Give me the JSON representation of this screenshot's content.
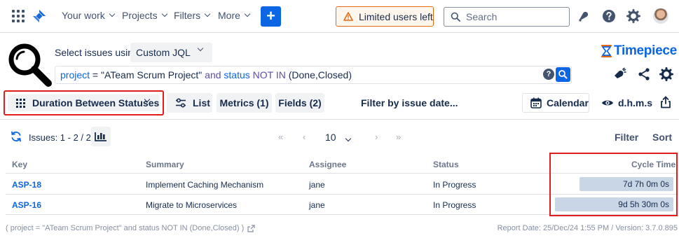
{
  "nav": {
    "items": [
      {
        "label": "Your work"
      },
      {
        "label": "Projects"
      },
      {
        "label": "Filters"
      },
      {
        "label": "More"
      }
    ],
    "create_label": "+",
    "limited_label": "Limited users left",
    "search_placeholder": "Search"
  },
  "header": {
    "select_label": "Select issues using",
    "jql_mode": "Custom JQL",
    "jql": {
      "t1": "project",
      "t2": " = \"ATeam Scrum Project\" ",
      "t3": "and",
      "t4": " ",
      "t5": "status",
      "t6": " NOT IN ",
      "t7": "(Done,Closed)"
    },
    "brand": "Timepiece"
  },
  "toolbar": {
    "report_type": "Duration Between Statuses",
    "list_label": "List",
    "metrics_label": "Metrics (1)",
    "fields_label": "Fields (2)",
    "filter_date_label": "Filter by issue date...",
    "calendar_label": "Calendar",
    "time_format_label": "d.h.m.s"
  },
  "pager": {
    "issues_label": "Issues: 1 - 2 / 2",
    "first": "«",
    "prev": "‹",
    "page_size": "10",
    "next": "›",
    "last": "»",
    "filter_label": "Filter",
    "sort_label": "Sort"
  },
  "table": {
    "headers": {
      "key": "Key",
      "summary": "Summary",
      "assignee": "Assignee",
      "status": "Status",
      "cycle_time": "Cycle Time"
    },
    "rows": [
      {
        "key": "ASP-18",
        "summary": "Implement Caching Mechanism",
        "assignee": "jane",
        "status": "In Progress",
        "cycle_time": "7d 7h 0m 0s",
        "cycle_fraction": 0.79
      },
      {
        "key": "ASP-16",
        "summary": "Migrate to Microservices",
        "assignee": "jane",
        "status": "In Progress",
        "cycle_time": "9d 5h 30m 0s",
        "cycle_fraction": 1.0
      }
    ]
  },
  "footer": {
    "query": "( project = \"ATeam Scrum Project\" and status NOT IN (Done,Closed) )",
    "report_info": "Report Date: 25/Dec/24 1:55 PM / Version: 3.7.0.895"
  },
  "colors": {
    "accent": "#0c66e4",
    "highlight_frame": "#e01e1e",
    "warning": "#e56910",
    "bar_fill": "#c9d6e6"
  }
}
